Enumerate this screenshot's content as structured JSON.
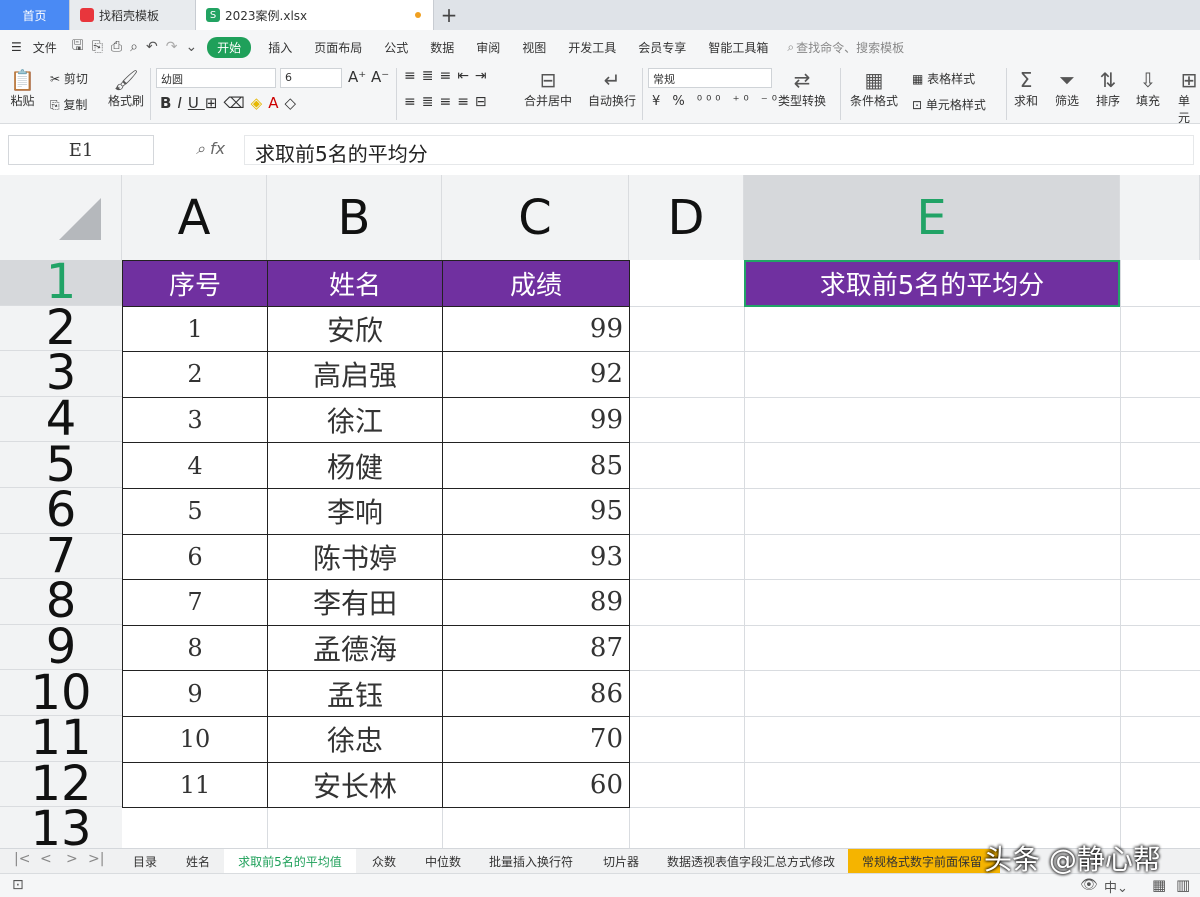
{
  "tabs": {
    "home": "首页",
    "template": "找稻壳模板",
    "file": "2023案例.xlsx",
    "new_tab": "+"
  },
  "menu": {
    "file": "文件",
    "items": [
      "开始",
      "插入",
      "页面布局",
      "公式",
      "数据",
      "审阅",
      "视图",
      "开发工具",
      "会员专享",
      "智能工具箱"
    ],
    "search": "查找命令、搜索模板"
  },
  "ribbon": {
    "paste": "粘贴",
    "cut": "剪切",
    "copy": "复制",
    "format_painter": "格式刷",
    "font": "幼圆",
    "size": "6",
    "merge": "合并居中",
    "wrap": "自动换行",
    "number_format": "常规",
    "type_convert": "类型转换",
    "cond_format": "条件格式",
    "table_style": "表格样式",
    "cell_style": "单元格样式",
    "sum": "求和",
    "filter": "筛选",
    "sort": "排序",
    "fill": "填充",
    "single": "单元"
  },
  "formula_bar": {
    "cell_ref": "E1",
    "fx": "fx",
    "content": "求取前5名的平均分"
  },
  "columns": [
    "A",
    "B",
    "C",
    "D",
    "E"
  ],
  "rows": [
    "1",
    "2",
    "3",
    "4",
    "5",
    "6",
    "7",
    "8",
    "9",
    "10",
    "11",
    "12",
    "13"
  ],
  "table": {
    "headers": [
      "序号",
      "姓名",
      "成绩"
    ],
    "e_header": "求取前5名的平均分",
    "data": [
      [
        "1",
        "安欣",
        "99"
      ],
      [
        "2",
        "高启强",
        "92"
      ],
      [
        "3",
        "徐江",
        "99"
      ],
      [
        "4",
        "杨健",
        "85"
      ],
      [
        "5",
        "李响",
        "95"
      ],
      [
        "6",
        "陈书婷",
        "93"
      ],
      [
        "7",
        "李有田",
        "89"
      ],
      [
        "8",
        "孟德海",
        "87"
      ],
      [
        "9",
        "孟钰",
        "86"
      ],
      [
        "10",
        "徐忠",
        "70"
      ],
      [
        "11",
        "安长林",
        "60"
      ]
    ]
  },
  "sheet_tabs": [
    "目录",
    "姓名",
    "求取前5名的平均值",
    "众数",
    "中位数",
    "批量插入换行符",
    "切片器",
    "数据透视表值字段汇总方式修改",
    "常规格式数字前面保留"
  ],
  "active_sheet": "求取前5名的平均值",
  "watermark": "头条 @静心帮",
  "colors": {
    "header_purple": "#7030a0",
    "accent_green": "#1fa05a",
    "home_tab_blue": "#4a8af4",
    "highlight_tab": "#f5b400"
  }
}
